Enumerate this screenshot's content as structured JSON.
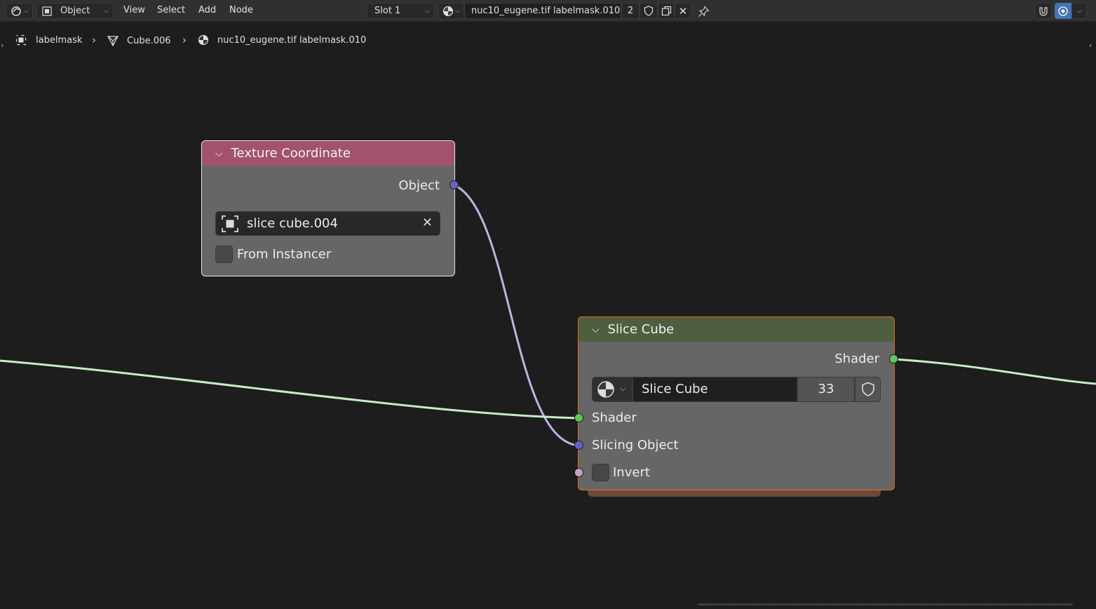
{
  "header": {
    "editor_type_icon": "node-editor-icon",
    "mode_label": "Object",
    "menus": [
      "View",
      "Select",
      "Add",
      "Node"
    ],
    "slot_label": "Slot 1",
    "material_name": "nuc10_eugene.tif labelmask.010",
    "user_count": "2"
  },
  "breadcrumb": {
    "items": [
      "labelmask",
      "Cube.006",
      "nuc10_eugene.tif labelmask.010"
    ]
  },
  "texture_node": {
    "title": "Texture Coordinate",
    "output_label": "Object",
    "object_field_value": "slice cube.004",
    "checkbox_label": "From Instancer"
  },
  "slice_node": {
    "title": "Slice Cube",
    "output_label": "Shader",
    "group_name": "Slice Cube",
    "group_users": "33",
    "inputs": [
      "Shader",
      "Slicing Object",
      "Invert"
    ]
  },
  "colors": {
    "texture_header": "#a2526c",
    "slice_header": "#4f5e3e",
    "shader_socket": "#5cc85c",
    "vector_socket": "#6363c7",
    "float_socket": "#c8a2c8",
    "selected_outline": "#e06a1b"
  }
}
